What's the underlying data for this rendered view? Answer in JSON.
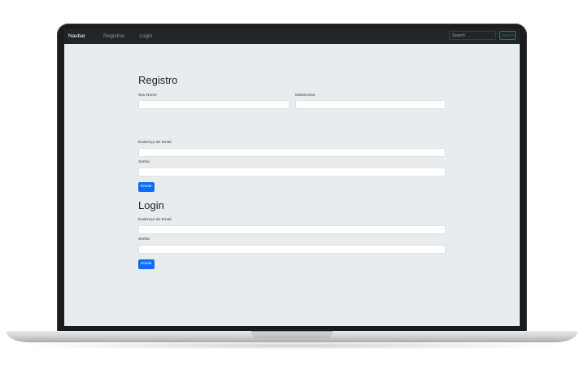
{
  "navbar": {
    "brand": "Navbar",
    "links": [
      "Registrar",
      "Login"
    ],
    "search_placeholder": "Search",
    "search_button": "Search"
  },
  "registro": {
    "title": "Registro",
    "first_name_label": "Seu Nome",
    "last_name_label": "Sobrenome",
    "email_label": "Endereço de Email",
    "password_label": "Senha",
    "submit_label": "Enviar"
  },
  "login": {
    "title": "Login",
    "email_label": "Endereço de Email",
    "password_label": "Senha",
    "submit_label": "Enviar"
  },
  "colors": {
    "navbar_bg": "#212529",
    "page_bg": "#e9ecef",
    "primary": "#0d6efd",
    "success": "#198754"
  }
}
